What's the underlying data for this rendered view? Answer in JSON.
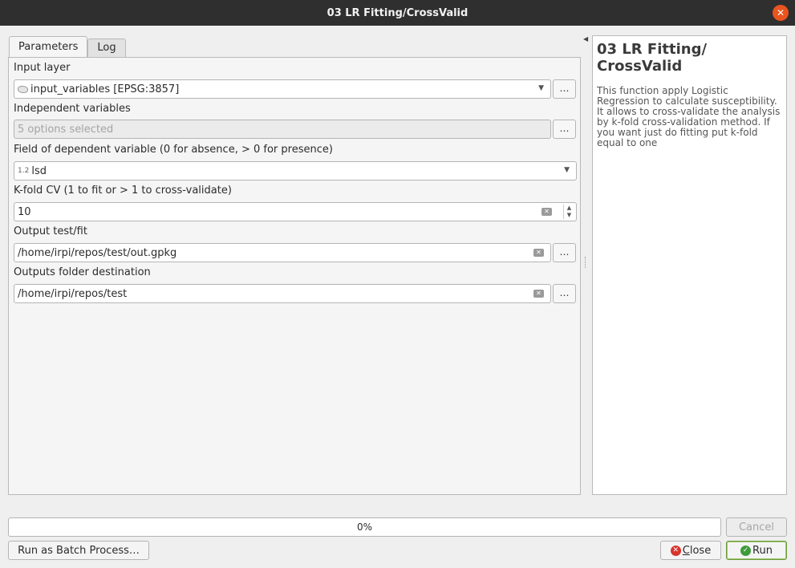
{
  "window": {
    "title": "03 LR Fitting/CrossValid",
    "close_glyph": "✕"
  },
  "tabs": [
    {
      "label": "Parameters",
      "active": true
    },
    {
      "label": "Log",
      "active": false
    }
  ],
  "params": {
    "input_layer": {
      "label": "Input layer",
      "value": "input_variables [EPSG:3857]",
      "icon": "polygon-layer-icon",
      "browse": "…"
    },
    "independent": {
      "label": "Independent variables",
      "value": "5 options selected",
      "browse": "…"
    },
    "dependent": {
      "label": "Field of dependent variable (0 for absence, > 0 for presence)",
      "prefix": "1.2",
      "value": "lsd"
    },
    "kfold": {
      "label": "K-fold CV (1 to fit or > 1 to cross-validate)",
      "value": "10"
    },
    "output_test": {
      "label": "Output test/fit",
      "value": "/home/irpi/repos/test/out.gpkg",
      "browse": "…"
    },
    "output_folder": {
      "label": "Outputs folder destination",
      "value": "/home/irpi/repos/test",
      "browse": "…"
    }
  },
  "help": {
    "title": "03 LR Fitting/ CrossValid",
    "body": "This function apply Logistic Regression to calculate susceptibility. It allows to cross-validate the analysis by k-fold cross-validation method. If you want just do fitting put k-fold equal to one"
  },
  "footer": {
    "progress": "0%",
    "progress_value": 0,
    "cancel": "Cancel",
    "batch": "Run as Batch Process…",
    "close_first": "C",
    "close_rest": "lose",
    "run": "Run"
  },
  "colors": {
    "titlebar": "#2f2f2f",
    "close_accent": "#e9541f",
    "run_accent": "#3e9b3a",
    "close_icon": "#d7352f"
  }
}
